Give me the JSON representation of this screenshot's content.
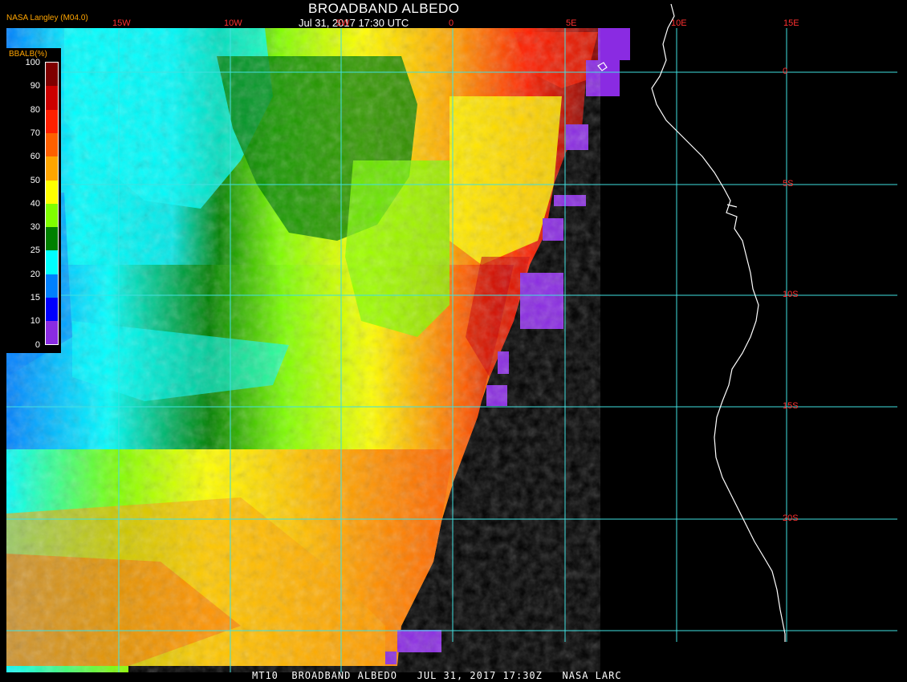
{
  "header": {
    "title": "BROADBAND ALBEDO",
    "subtitle": "Jul 31, 2017 17:30 UTC",
    "agency": "NASA Langley (M04.0)"
  },
  "footer": {
    "text": "MT10  BROADBAND ALBEDO   JUL 31, 2017 17:30Z   NASA LARC"
  },
  "legend": {
    "title": "BBALB(%)",
    "labels": [
      "100",
      "90",
      "80",
      "70",
      "60",
      "50",
      "40",
      "30",
      "25",
      "20",
      "15",
      "10",
      "0"
    ],
    "colors": [
      "#7f0000",
      "#cc0000",
      "#ff2000",
      "#ff6000",
      "#ffa500",
      "#ffff00",
      "#80ff00",
      "#008000",
      "#00ffff",
      "#0080ff",
      "#0000ff",
      "#8a2be2"
    ]
  },
  "axes": {
    "lon_labels": [
      "15W",
      "10W",
      "5W",
      "0",
      "5E",
      "10E",
      "15E"
    ],
    "lat_labels": [
      "0",
      "5S",
      "10S",
      "15S",
      "20S"
    ],
    "lon_values": [
      -15,
      -10,
      -5,
      0,
      5,
      10,
      15
    ],
    "lat_values": [
      0,
      -5,
      -10,
      -15,
      -20
    ]
  },
  "colors": {
    "grid": "#40e0e0",
    "coastline": "#ffffff",
    "no_data": "#000000",
    "label_land": "#ff3030"
  }
}
